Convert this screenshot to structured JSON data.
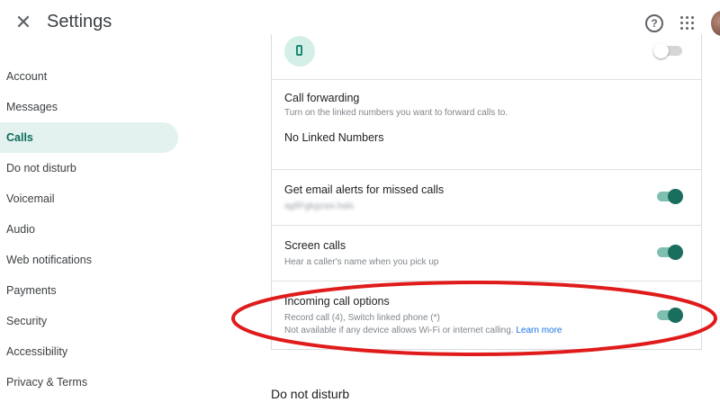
{
  "header": {
    "close_icon": "close-icon",
    "close_glyph": "✕",
    "title": "Settings",
    "help_icon": "help-icon",
    "help_glyph": "?",
    "apps_icon": "apps-grid-icon"
  },
  "sidebar": {
    "items": [
      {
        "label": "Account"
      },
      {
        "label": "Messages"
      },
      {
        "label": "Calls",
        "active": true
      },
      {
        "label": "Do not disturb"
      },
      {
        "label": "Voicemail"
      },
      {
        "label": "Audio"
      },
      {
        "label": "Web notifications"
      },
      {
        "label": "Payments"
      },
      {
        "label": "Security"
      },
      {
        "label": "Accessibility"
      },
      {
        "label": "Privacy & Terms"
      }
    ]
  },
  "main": {
    "top_row": {
      "icon": "phone-icon",
      "toggle_on": false
    },
    "call_forwarding": {
      "title": "Call forwarding",
      "subtitle": "Turn on the linked numbers you want to forward calls to.",
      "value": "No Linked Numbers"
    },
    "email_alerts": {
      "title": "Get email alerts for missed calls",
      "subtitle": "agfiFgkgzasi.bals",
      "toggle_on": true
    },
    "screen_calls": {
      "title": "Screen calls",
      "subtitle": "Hear a caller's name when you pick up",
      "toggle_on": true
    },
    "incoming_call_options": {
      "title": "Incoming call options",
      "line1": "Record call (4), Switch linked phone (*)",
      "line2": "Not available if any device allows Wi-Fi or internet calling.",
      "learn_more": "Learn more",
      "toggle_on": true
    },
    "next_section_heading": "Do not disturb"
  },
  "colors": {
    "accent": "#1a6e5e",
    "accent_light": "#e3f2ef",
    "highlight_ring": "#e01b1b",
    "link": "#1a73e8"
  }
}
